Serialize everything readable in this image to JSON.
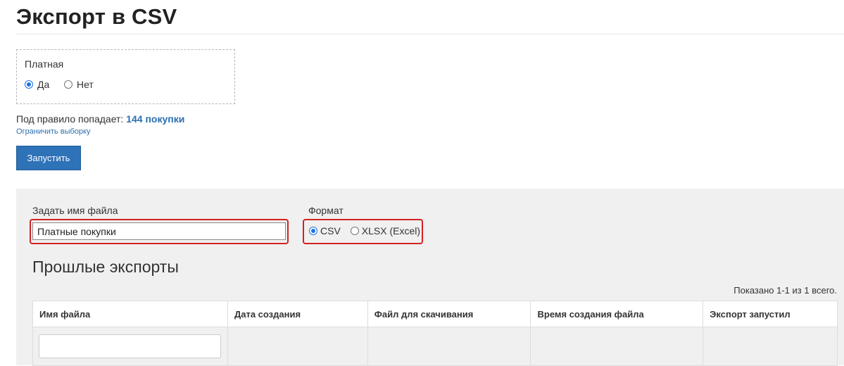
{
  "page": {
    "title": "Экспорт в CSV"
  },
  "filter": {
    "label": "Платная",
    "options": [
      {
        "label": "Да",
        "checked": true
      },
      {
        "label": "Нет",
        "checked": false
      }
    ]
  },
  "rule": {
    "prefix": "Под правило попадает:",
    "count_text": "144 покупки",
    "limit_link": "Ограничить выборку"
  },
  "run_button": {
    "label": "Запустить"
  },
  "export_form": {
    "filename_label": "Задать имя файла",
    "filename_value": "Платные покупки",
    "format_label": "Формат",
    "format_options": [
      {
        "label": "CSV",
        "checked": true
      },
      {
        "label": "XLSX (Excel)",
        "checked": false
      }
    ]
  },
  "past_exports": {
    "title": "Прошлые экспорты",
    "summary": "Показано 1-1 из 1 всего.",
    "columns": [
      "Имя файла",
      "Дата создания",
      "Файл для скачивания",
      "Время создания файла",
      "Экспорт запустил"
    ],
    "filter_value": ""
  },
  "colors": {
    "accent": "#2e72b8",
    "link": "#2a6fb0",
    "highlight": "#d32222",
    "panel": "#f0f0f0"
  }
}
